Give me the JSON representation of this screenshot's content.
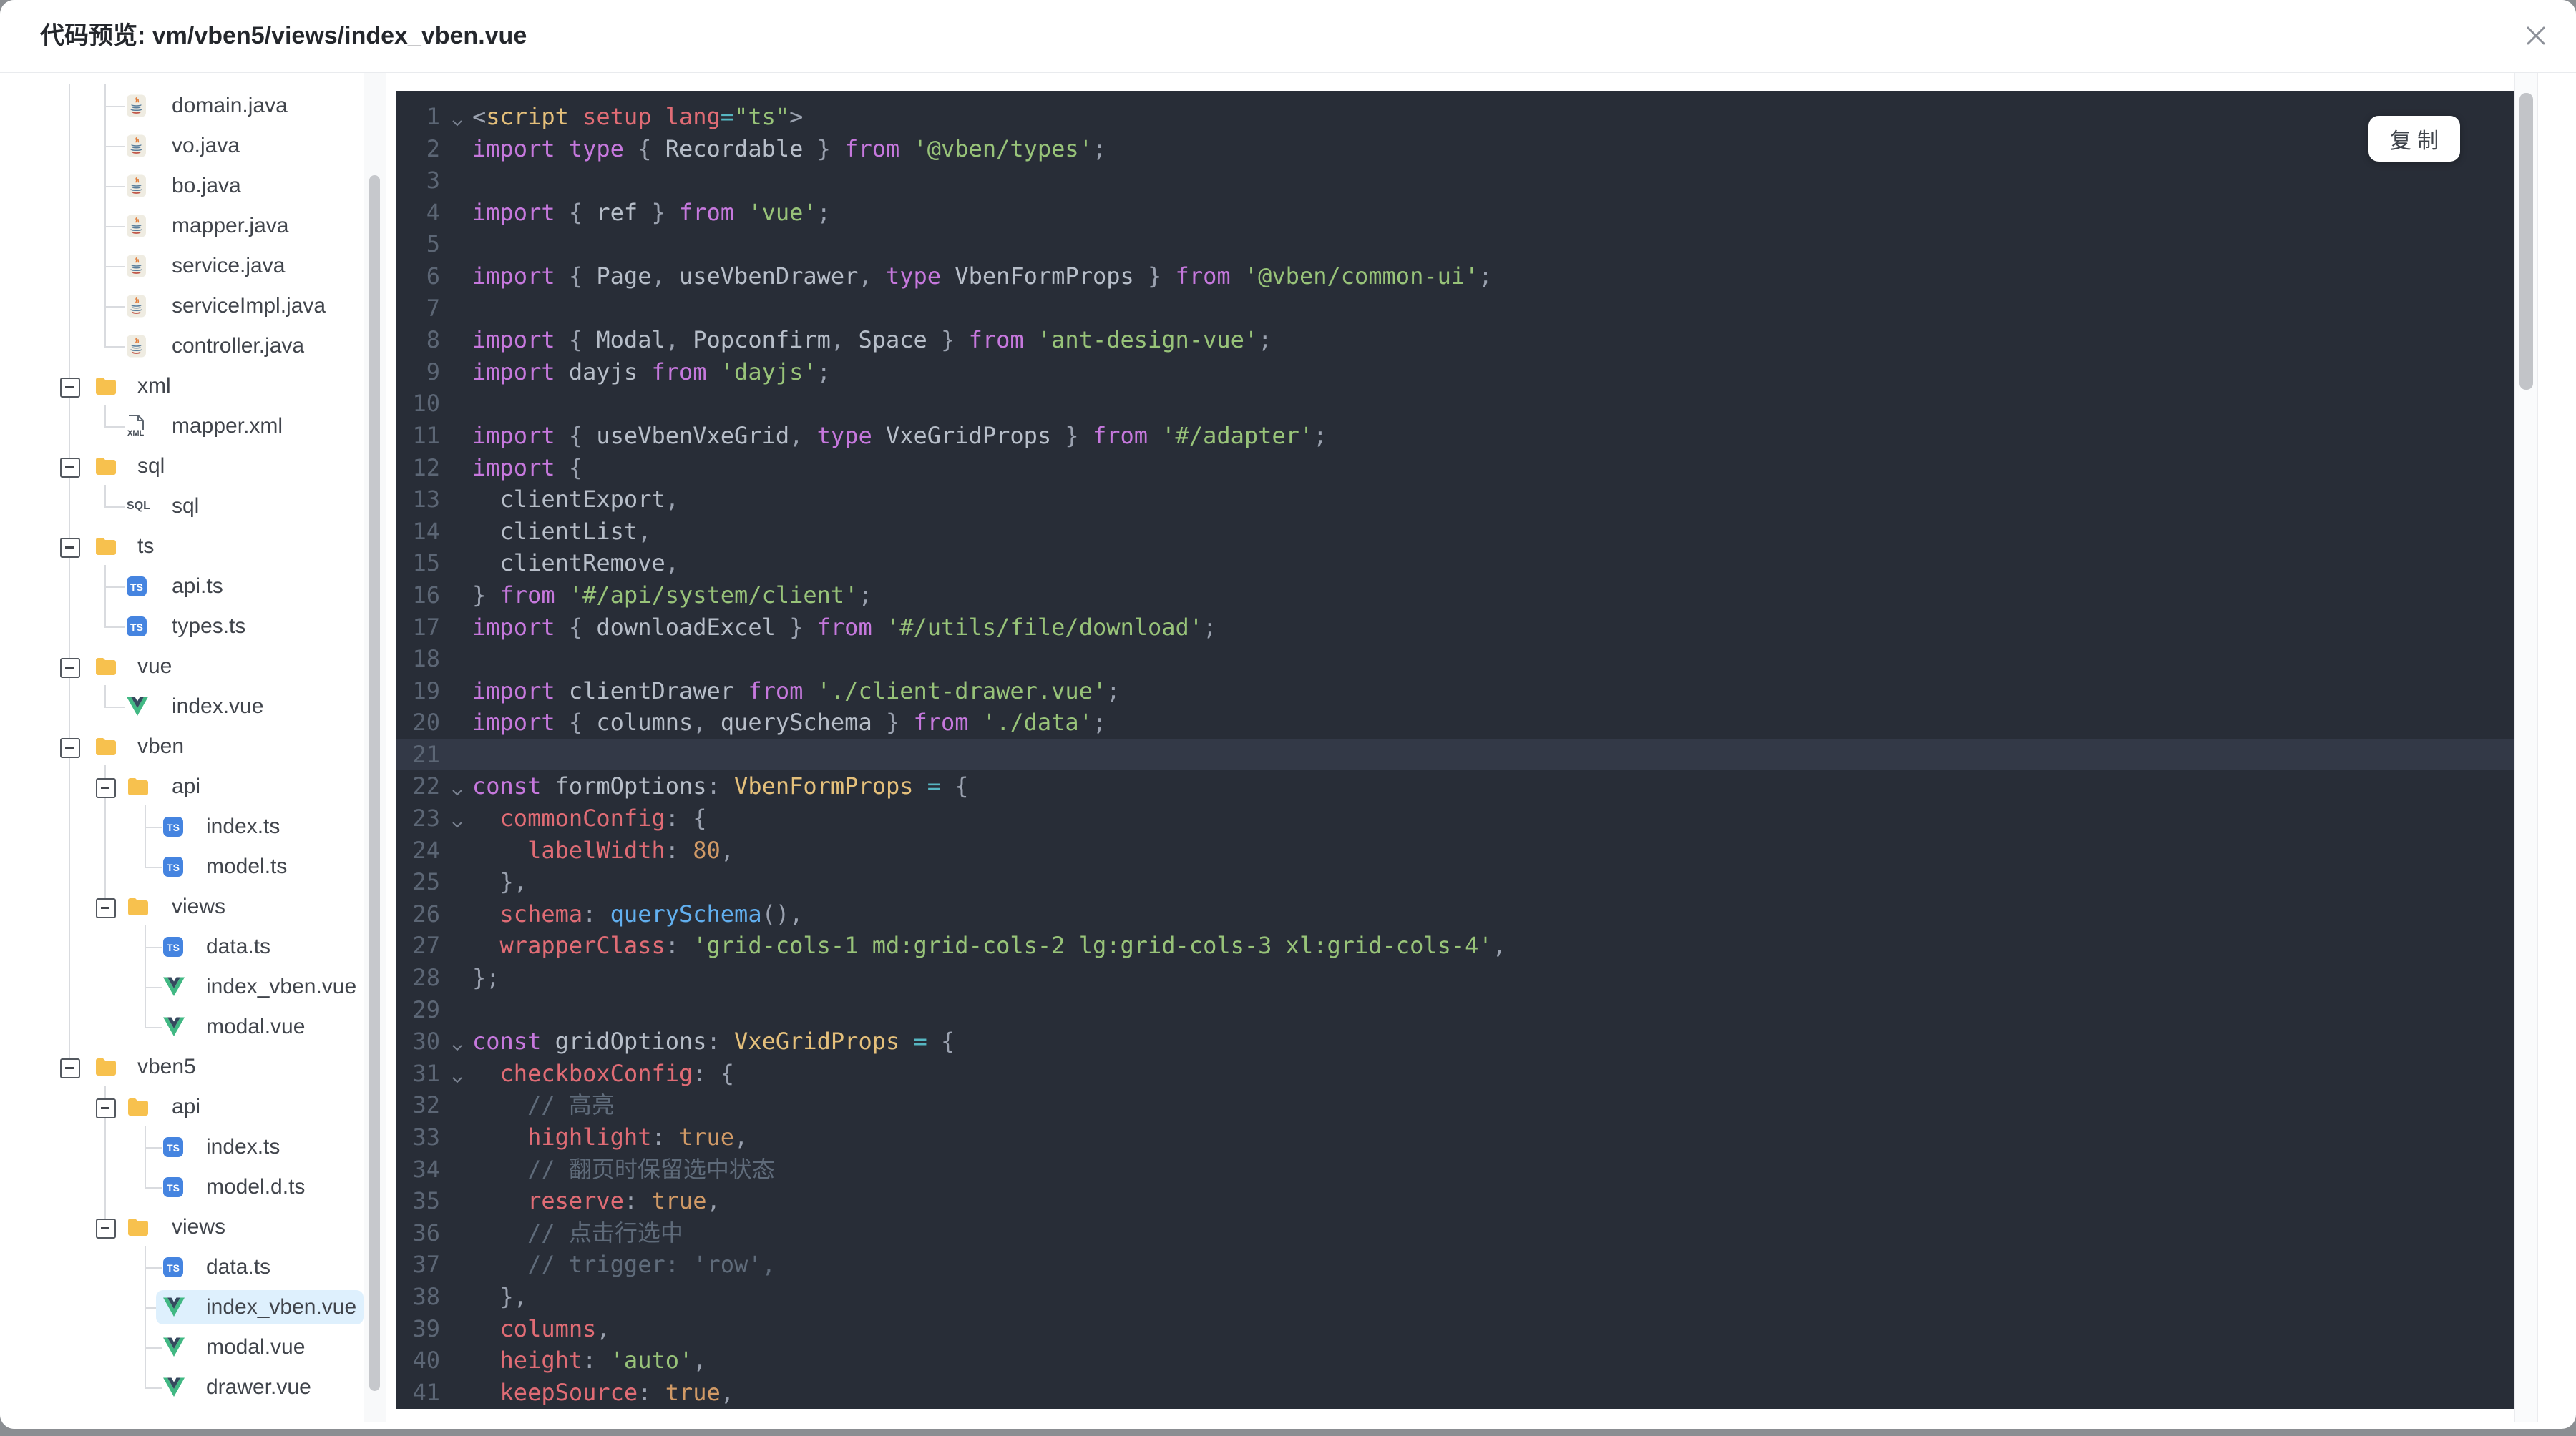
{
  "dialog": {
    "title": "代码预览: vm/vben5/views/index_vben.vue"
  },
  "editor": {
    "copy_label": "复 制",
    "background": "#282d37",
    "current_line": 21,
    "token_colors": {
      "p": "#9aa1af",
      "w": "#b7bec9",
      "k": "#c678dd",
      "s": "#98c379",
      "y": "#e5c07b",
      "r": "#e06c75",
      "o": "#d19a66",
      "b": "#61afef",
      "c": "#56b6c2",
      "g": "#5f6b7a"
    }
  },
  "tree": {
    "selected": "index_vben.vue",
    "items": [
      {
        "label": "domain.java",
        "icon": "java",
        "lvl": 2
      },
      {
        "label": "vo.java",
        "icon": "java",
        "lvl": 2
      },
      {
        "label": "bo.java",
        "icon": "java",
        "lvl": 2
      },
      {
        "label": "mapper.java",
        "icon": "java",
        "lvl": 2
      },
      {
        "label": "service.java",
        "icon": "java",
        "lvl": 2
      },
      {
        "label": "serviceImpl.java",
        "icon": "java",
        "lvl": 2
      },
      {
        "label": "controller.java",
        "icon": "java",
        "lvl": 2
      },
      {
        "label": "xml",
        "icon": "folder",
        "lvl": 1,
        "folder": true
      },
      {
        "label": "mapper.xml",
        "icon": "xml",
        "lvl": 2
      },
      {
        "label": "sql",
        "icon": "folder",
        "lvl": 1,
        "folder": true
      },
      {
        "label": "sql",
        "icon": "sql",
        "lvl": 2
      },
      {
        "label": "ts",
        "icon": "folder",
        "lvl": 1,
        "folder": true
      },
      {
        "label": "api.ts",
        "icon": "ts",
        "lvl": 2
      },
      {
        "label": "types.ts",
        "icon": "ts",
        "lvl": 2
      },
      {
        "label": "vue",
        "icon": "folder",
        "lvl": 1,
        "folder": true
      },
      {
        "label": "index.vue",
        "icon": "vue",
        "lvl": 2
      },
      {
        "label": "vben",
        "icon": "folder",
        "lvl": 1,
        "folder": true
      },
      {
        "label": "api",
        "icon": "folder",
        "lvl": 2,
        "folder": true
      },
      {
        "label": "index.ts",
        "icon": "ts",
        "lvl": 3
      },
      {
        "label": "model.ts",
        "icon": "ts",
        "lvl": 3
      },
      {
        "label": "views",
        "icon": "folder",
        "lvl": 2,
        "folder": true
      },
      {
        "label": "data.ts",
        "icon": "ts",
        "lvl": 3
      },
      {
        "label": "index_vben.vue",
        "icon": "vue",
        "lvl": 3
      },
      {
        "label": "modal.vue",
        "icon": "vue",
        "lvl": 3
      },
      {
        "label": "vben5",
        "icon": "folder",
        "lvl": 1,
        "folder": true
      },
      {
        "label": "api",
        "icon": "folder",
        "lvl": 2,
        "folder": true
      },
      {
        "label": "index.ts",
        "icon": "ts",
        "lvl": 3
      },
      {
        "label": "model.d.ts",
        "icon": "ts",
        "lvl": 3
      },
      {
        "label": "views",
        "icon": "folder",
        "lvl": 2,
        "folder": true
      },
      {
        "label": "data.ts",
        "icon": "ts",
        "lvl": 3
      },
      {
        "label": "index_vben.vue",
        "icon": "vue",
        "lvl": 3,
        "sel": true
      },
      {
        "label": "modal.vue",
        "icon": "vue",
        "lvl": 3
      },
      {
        "label": "drawer.vue",
        "icon": "vue",
        "lvl": 3
      }
    ]
  },
  "code": {
    "lines": [
      {
        "n": 1,
        "fold": true,
        "tokens": [
          [
            "<",
            "p"
          ],
          [
            "script",
            "y"
          ],
          [
            " ",
            "p"
          ],
          [
            "setup",
            "r"
          ],
          [
            " ",
            "p"
          ],
          [
            "lang",
            "r"
          ],
          [
            "=",
            "c"
          ],
          [
            "\"ts\"",
            "s"
          ],
          [
            ">",
            "p"
          ]
        ]
      },
      {
        "n": 2,
        "tokens": [
          [
            "import type ",
            "k"
          ],
          [
            "{ ",
            "p"
          ],
          [
            "Recordable",
            "w"
          ],
          [
            " } ",
            "p"
          ],
          [
            "from ",
            "k"
          ],
          [
            "'@vben/types'",
            "s"
          ],
          [
            ";",
            "p"
          ]
        ]
      },
      {
        "n": 3,
        "tokens": []
      },
      {
        "n": 4,
        "tokens": [
          [
            "import ",
            "k"
          ],
          [
            "{ ",
            "p"
          ],
          [
            "ref",
            "w"
          ],
          [
            " } ",
            "p"
          ],
          [
            "from ",
            "k"
          ],
          [
            "'vue'",
            "s"
          ],
          [
            ";",
            "p"
          ]
        ]
      },
      {
        "n": 5,
        "tokens": []
      },
      {
        "n": 6,
        "tokens": [
          [
            "import ",
            "k"
          ],
          [
            "{ ",
            "p"
          ],
          [
            "Page",
            "w"
          ],
          [
            ", ",
            "p"
          ],
          [
            "useVbenDrawer",
            "w"
          ],
          [
            ", ",
            "p"
          ],
          [
            "type ",
            "k"
          ],
          [
            "VbenFormProps",
            "w"
          ],
          [
            " } ",
            "p"
          ],
          [
            "from ",
            "k"
          ],
          [
            "'@vben/common-ui'",
            "s"
          ],
          [
            ";",
            "p"
          ]
        ]
      },
      {
        "n": 7,
        "tokens": []
      },
      {
        "n": 8,
        "tokens": [
          [
            "import ",
            "k"
          ],
          [
            "{ ",
            "p"
          ],
          [
            "Modal",
            "w"
          ],
          [
            ", ",
            "p"
          ],
          [
            "Popconfirm",
            "w"
          ],
          [
            ", ",
            "p"
          ],
          [
            "Space",
            "w"
          ],
          [
            " } ",
            "p"
          ],
          [
            "from ",
            "k"
          ],
          [
            "'ant-design-vue'",
            "s"
          ],
          [
            ";",
            "p"
          ]
        ]
      },
      {
        "n": 9,
        "tokens": [
          [
            "import ",
            "k"
          ],
          [
            "dayjs ",
            "w"
          ],
          [
            "from ",
            "k"
          ],
          [
            "'dayjs'",
            "s"
          ],
          [
            ";",
            "p"
          ]
        ]
      },
      {
        "n": 10,
        "tokens": []
      },
      {
        "n": 11,
        "tokens": [
          [
            "import ",
            "k"
          ],
          [
            "{ ",
            "p"
          ],
          [
            "useVbenVxeGrid",
            "w"
          ],
          [
            ", ",
            "p"
          ],
          [
            "type ",
            "k"
          ],
          [
            "VxeGridProps",
            "w"
          ],
          [
            " } ",
            "p"
          ],
          [
            "from ",
            "k"
          ],
          [
            "'#/adapter'",
            "s"
          ],
          [
            ";",
            "p"
          ]
        ]
      },
      {
        "n": 12,
        "tokens": [
          [
            "import ",
            "k"
          ],
          [
            "{",
            "p"
          ]
        ]
      },
      {
        "n": 13,
        "tokens": [
          [
            "  clientExport",
            "w"
          ],
          [
            ",",
            "p"
          ]
        ]
      },
      {
        "n": 14,
        "tokens": [
          [
            "  clientList",
            "w"
          ],
          [
            ",",
            "p"
          ]
        ]
      },
      {
        "n": 15,
        "tokens": [
          [
            "  clientRemove",
            "w"
          ],
          [
            ",",
            "p"
          ]
        ]
      },
      {
        "n": 16,
        "tokens": [
          [
            "} ",
            "p"
          ],
          [
            "from ",
            "k"
          ],
          [
            "'#/api/system/client'",
            "s"
          ],
          [
            ";",
            "p"
          ]
        ]
      },
      {
        "n": 17,
        "tokens": [
          [
            "import ",
            "k"
          ],
          [
            "{ ",
            "p"
          ],
          [
            "downloadExcel",
            "w"
          ],
          [
            " } ",
            "p"
          ],
          [
            "from ",
            "k"
          ],
          [
            "'#/utils/file/download'",
            "s"
          ],
          [
            ";",
            "p"
          ]
        ]
      },
      {
        "n": 18,
        "tokens": []
      },
      {
        "n": 19,
        "tokens": [
          [
            "import ",
            "k"
          ],
          [
            "clientDrawer ",
            "w"
          ],
          [
            "from ",
            "k"
          ],
          [
            "'./client-drawer.vue'",
            "s"
          ],
          [
            ";",
            "p"
          ]
        ]
      },
      {
        "n": 20,
        "tokens": [
          [
            "import ",
            "k"
          ],
          [
            "{ ",
            "p"
          ],
          [
            "columns",
            "w"
          ],
          [
            ", ",
            "p"
          ],
          [
            "querySchema",
            "w"
          ],
          [
            " } ",
            "p"
          ],
          [
            "from ",
            "k"
          ],
          [
            "'./data'",
            "s"
          ],
          [
            ";",
            "p"
          ]
        ]
      },
      {
        "n": 21,
        "hl": true,
        "tokens": []
      },
      {
        "n": 22,
        "fold": true,
        "tokens": [
          [
            "const ",
            "k"
          ],
          [
            "formOptions",
            "w"
          ],
          [
            ": ",
            "p"
          ],
          [
            "VbenFormProps",
            "y"
          ],
          [
            " ",
            "p"
          ],
          [
            "=",
            "c"
          ],
          [
            " {",
            "p"
          ]
        ]
      },
      {
        "n": 23,
        "fold": true,
        "tokens": [
          [
            "  ",
            "p"
          ],
          [
            "commonConfig",
            "r"
          ],
          [
            ": {",
            "p"
          ]
        ]
      },
      {
        "n": 24,
        "tokens": [
          [
            "    ",
            "p"
          ],
          [
            "labelWidth",
            "r"
          ],
          [
            ": ",
            "p"
          ],
          [
            "80",
            "o"
          ],
          [
            ",",
            "p"
          ]
        ]
      },
      {
        "n": 25,
        "tokens": [
          [
            "  },",
            "p"
          ]
        ]
      },
      {
        "n": 26,
        "tokens": [
          [
            "  ",
            "p"
          ],
          [
            "schema",
            "r"
          ],
          [
            ": ",
            "p"
          ],
          [
            "querySchema",
            "b"
          ],
          [
            "(),",
            "p"
          ]
        ]
      },
      {
        "n": 27,
        "tokens": [
          [
            "  ",
            "p"
          ],
          [
            "wrapperClass",
            "r"
          ],
          [
            ": ",
            "p"
          ],
          [
            "'grid-cols-1 md:grid-cols-2 lg:grid-cols-3 xl:grid-cols-4'",
            "s"
          ],
          [
            ",",
            "p"
          ]
        ]
      },
      {
        "n": 28,
        "tokens": [
          [
            "};",
            "p"
          ]
        ]
      },
      {
        "n": 29,
        "tokens": []
      },
      {
        "n": 30,
        "fold": true,
        "tokens": [
          [
            "const ",
            "k"
          ],
          [
            "gridOptions",
            "w"
          ],
          [
            ": ",
            "p"
          ],
          [
            "VxeGridProps",
            "y"
          ],
          [
            " ",
            "p"
          ],
          [
            "=",
            "c"
          ],
          [
            " {",
            "p"
          ]
        ]
      },
      {
        "n": 31,
        "fold": true,
        "tokens": [
          [
            "  ",
            "p"
          ],
          [
            "checkboxConfig",
            "r"
          ],
          [
            ": {",
            "p"
          ]
        ]
      },
      {
        "n": 32,
        "tokens": [
          [
            "    // 高亮",
            "g"
          ]
        ]
      },
      {
        "n": 33,
        "tokens": [
          [
            "    ",
            "p"
          ],
          [
            "highlight",
            "r"
          ],
          [
            ": ",
            "p"
          ],
          [
            "true",
            "o"
          ],
          [
            ",",
            "p"
          ]
        ]
      },
      {
        "n": 34,
        "tokens": [
          [
            "    // 翻页时保留选中状态",
            "g"
          ]
        ]
      },
      {
        "n": 35,
        "tokens": [
          [
            "    ",
            "p"
          ],
          [
            "reserve",
            "r"
          ],
          [
            ": ",
            "p"
          ],
          [
            "true",
            "o"
          ],
          [
            ",",
            "p"
          ]
        ]
      },
      {
        "n": 36,
        "tokens": [
          [
            "    // 点击行选中",
            "g"
          ]
        ]
      },
      {
        "n": 37,
        "tokens": [
          [
            "    // trigger: 'row',",
            "g"
          ]
        ]
      },
      {
        "n": 38,
        "tokens": [
          [
            "  },",
            "p"
          ]
        ]
      },
      {
        "n": 39,
        "tokens": [
          [
            "  ",
            "p"
          ],
          [
            "columns",
            "r"
          ],
          [
            ",",
            "p"
          ]
        ]
      },
      {
        "n": 40,
        "tokens": [
          [
            "  ",
            "p"
          ],
          [
            "height",
            "r"
          ],
          [
            ": ",
            "p"
          ],
          [
            "'auto'",
            "s"
          ],
          [
            ",",
            "p"
          ]
        ]
      },
      {
        "n": 41,
        "tokens": [
          [
            "  ",
            "p"
          ],
          [
            "keepSource",
            "r"
          ],
          [
            ": ",
            "p"
          ],
          [
            "true",
            "o"
          ],
          [
            ",",
            "p"
          ]
        ]
      }
    ]
  }
}
